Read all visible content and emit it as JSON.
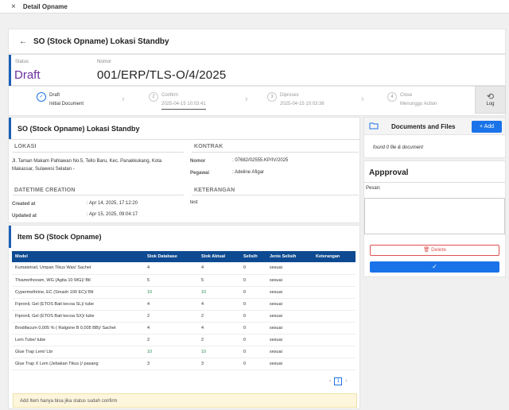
{
  "topbar": {
    "close_icon": "×",
    "title": "Detail Opname"
  },
  "header": {
    "back_icon": "←",
    "title": "SO (Stock Opname) Lokasi Standby"
  },
  "status": {
    "status_label": "Status",
    "status_value": "Draft",
    "nomor_label": "Nomor",
    "nomor_value": "001/ERP/TLS-O/4/2025"
  },
  "steps": [
    {
      "num": "✓",
      "title": "Draft",
      "sub": "Initial Document"
    },
    {
      "num": "2",
      "title": "Confirm",
      "sub": "2025-04-15 10:03:41"
    },
    {
      "num": "3",
      "title": "Diproses",
      "sub": "2025-04-15 10:03:36"
    },
    {
      "num": "4",
      "title": "Close",
      "sub": "Menunggu Action"
    }
  ],
  "log": {
    "icon": "⟲",
    "label": "Log"
  },
  "detail": {
    "title": "SO (Stock Opname) Lokasi Standby",
    "lokasi_label": "LOKASI",
    "lokasi_text": "Jl. Taman Makam Pahlawan No.5, Tello Baru, Kec. Panakkukang, Kota Makassar, Sulawesi Selatan -",
    "kontrak_label": "KONTRAK",
    "nomor_key": "Nomor",
    "nomor_val": ": 07682/02555.KP/IV/2025",
    "pegawai_key": "Pegawai",
    "pegawai_val": ": Adeline Afigar",
    "datetime_label": "DATETIME CREATION",
    "created_key": "Created at",
    "created_val": ": Apr 14, 2025, 17:12:20",
    "updated_key": "Updated at",
    "updated_val": ": Apr 15, 2025, 09:04:17",
    "keterangan_label": "KETERANGAN",
    "keterangan_val": "test"
  },
  "items": {
    "title": "Item SO (Stock Opname)",
    "columns": [
      "Model",
      "Stok Database",
      "Stok Aktual",
      "Selisih",
      "Jenis Selisih",
      "Keterangan"
    ],
    "rows": [
      [
        "Kumatetrail, Umpan Tikus Wax/ Sachet",
        "4",
        "4",
        "0",
        "sesuai",
        ""
      ],
      [
        "Thiamethoxam, WG (Agita 10 WG)/ Btl",
        "5",
        "5",
        "0",
        "sesuai",
        ""
      ],
      [
        "Cypermethrine, EC (Smash 100 EC)/ Btl",
        "10",
        "10",
        "0",
        "sesuai",
        ""
      ],
      [
        "Fipronil, Gel (ETOS Bait kecoa SL)/ tube",
        "4",
        "4",
        "0",
        "sesuai",
        ""
      ],
      [
        "Fipronil, Gel (ETOS Bait kecoa SX)/ tube",
        "2",
        "2",
        "0",
        "sesuai",
        ""
      ],
      [
        "Brodifacum 0,005 % ( Ratgone B 0,005 BB)/ Sachet",
        "4",
        "4",
        "0",
        "sesuai",
        ""
      ],
      [
        "Lem Tube/ tube",
        "2",
        "2",
        "0",
        "sesuai",
        ""
      ],
      [
        "Glue Trap Lem/ Lbr",
        "10",
        "10",
        "0",
        "sesuai",
        ""
      ],
      [
        "Glue Trap X Lem (Jebakan Tikus )/ pasang",
        "3",
        "3",
        "0",
        "sesuai",
        ""
      ]
    ],
    "page": "1",
    "prev_icon": "‹",
    "next_icon": "›",
    "note": "Add Item hanya bisa jika status sudah confirm"
  },
  "documents": {
    "title": "Documents and Files",
    "folder_icon": "folder-icon",
    "add_label": "+ Add",
    "empty_text": "found 0 file & document"
  },
  "approval": {
    "title": "Appproval",
    "pesan_label": "Pesan:",
    "pesan_value": "",
    "delete_label": "Delete",
    "delete_icon": "🗑",
    "confirm_icon": "✓"
  },
  "colors": {
    "accent": "#1a5fb4",
    "status": "#6b2fa0",
    "primary": "#1a73e8",
    "table_head": "#0d4a91",
    "danger": "#e05050"
  }
}
